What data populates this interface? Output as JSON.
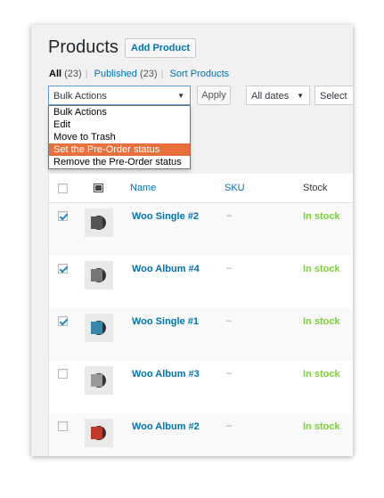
{
  "page": {
    "title": "Products",
    "add_button": "Add Product"
  },
  "filters": {
    "all_label": "All",
    "all_count": "(23)",
    "published_label": "Published",
    "published_count": "(23)",
    "sort_label": "Sort Products"
  },
  "bulk": {
    "selected": "Bulk Actions",
    "apply": "Apply",
    "options": [
      "Bulk Actions",
      "Edit",
      "Move to Trash",
      "Set the Pre-Order status",
      "Remove the Pre-Order status"
    ],
    "highlighted_option": "Set the Pre-Order status"
  },
  "dates_filter": "All dates",
  "category_filter": "Select",
  "table": {
    "columns": {
      "name": "Name",
      "sku": "SKU",
      "stock": "Stock"
    },
    "rows": [
      {
        "name": "Woo Single #2",
        "sku": "–",
        "stock": "In stock",
        "checked": true,
        "cover_color": "#555555"
      },
      {
        "name": "Woo Album #4",
        "sku": "–",
        "stock": "In stock",
        "checked": true,
        "cover_color": "#777777"
      },
      {
        "name": "Woo Single #1",
        "sku": "–",
        "stock": "In stock",
        "checked": true,
        "cover_color": "#3a87ad"
      },
      {
        "name": "Woo Album #3",
        "sku": "–",
        "stock": "In stock",
        "checked": false,
        "cover_color": "#999999"
      },
      {
        "name": "Woo Album #2",
        "sku": "–",
        "stock": "In stock",
        "checked": false,
        "cover_color": "#c0392b"
      }
    ]
  },
  "colors": {
    "link": "#0073aa",
    "in_stock": "#7ad03a",
    "highlight": "#e8703a"
  }
}
